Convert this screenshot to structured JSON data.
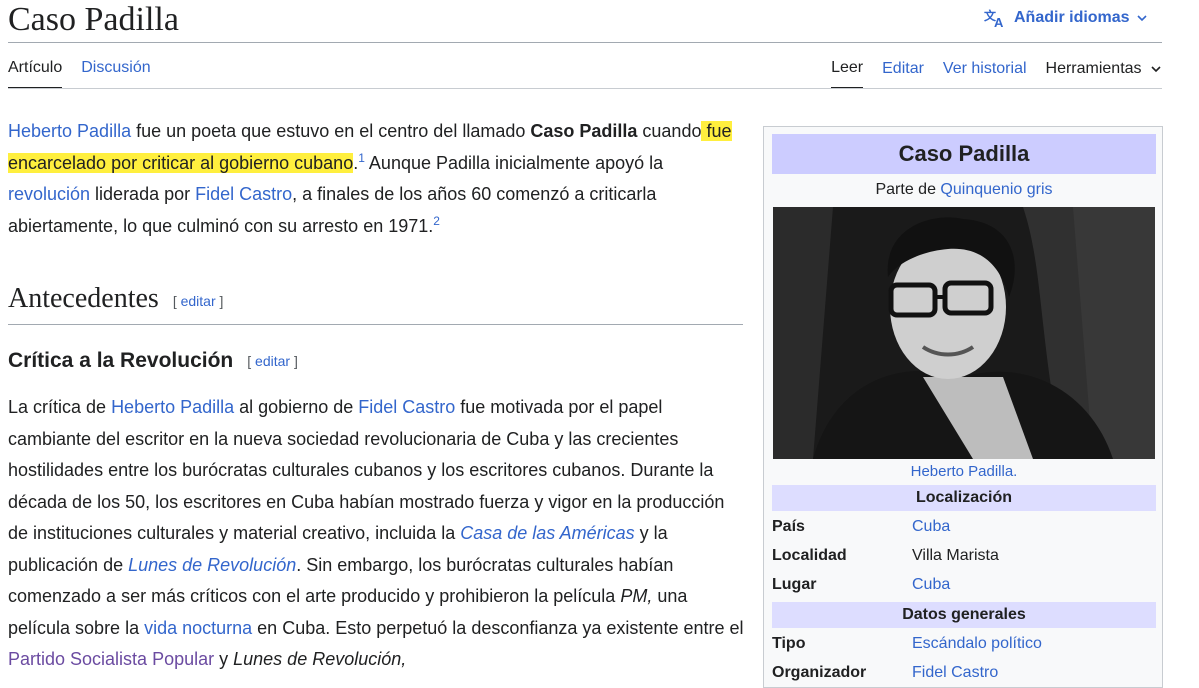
{
  "page": {
    "title": "Caso Padilla",
    "lang_button": "Añadir idiomas"
  },
  "tabs": {
    "left": [
      "Artículo",
      "Discusión"
    ],
    "right": [
      "Leer",
      "Editar",
      "Ver historial",
      "Herramientas"
    ]
  },
  "intro": {
    "link1": "Heberto Padilla",
    "t1": " fue un poeta que estuvo en el centro del llamado ",
    "bold": "Caso Padilla",
    "t2": " cuando",
    "highlight": " fue encarcelado por criticar al gobierno cubano",
    "t3": ".",
    "ref1": "1",
    "t4": "  Aunque Padilla inicialmente apoyó la ",
    "link2": "revolución",
    "t5": " liderada por ",
    "link3": "Fidel Castro",
    "t6": ", a finales de los años 60 comenzó a criticarla abiertamente, lo que culminó con su arresto en 1971.",
    "ref2": "2"
  },
  "section": {
    "heading": "Antecedentes",
    "edit_open": "[ ",
    "edit_label": "editar",
    "edit_close": " ]"
  },
  "subsection": {
    "heading": "Crítica a la Revolución",
    "edit_open": "[ ",
    "edit_label": "editar",
    "edit_close": " ]"
  },
  "body": {
    "t1": "La crítica de ",
    "link1": "Heberto Padilla",
    "t2": " al gobierno de ",
    "link2": "Fidel Castro",
    "t3": " fue motivada por el papel cambiante del escritor en la nueva sociedad revolucionaria de Cuba y las crecientes hostilidades entre los burócratas culturales cubanos y los escritores cubanos. Durante la década de los 50, los escritores en Cuba habían mostrado fuerza y vigor en la producción de instituciones culturales y material creativo, incluida la ",
    "link3": "Casa de las Américas",
    "t4": " y la publicación de ",
    "link4": "Lunes de Revolución",
    "t5": ". Sin embargo, los burócratas culturales habían comenzado a ser más críticos con el arte producido y prohibieron la película ",
    "italic1": "PM,",
    "t6": " una película sobre la ",
    "link5": "vida nocturna",
    "t7": " en Cuba. Esto perpetuó la desconfianza ya existente entre el ",
    "link6": "Partido Socialista Popular",
    "t8": " y ",
    "italic2": "Lunes de Revolución,"
  },
  "infobox": {
    "title": "Caso Padilla",
    "subtitle_prefix": "Parte de ",
    "subtitle_link": "Quinquenio gris",
    "caption": "Heberto Padilla.",
    "header1": "Localización",
    "rows1": [
      {
        "label": "País",
        "value": "Cuba"
      },
      {
        "label": "Localidad",
        "value": "Villa Marista"
      },
      {
        "label": "Lugar",
        "value": "Cuba"
      }
    ],
    "header2": "Datos generales",
    "rows2": [
      {
        "label": "Tipo",
        "value": "Escándalo político"
      },
      {
        "label": "Organizador",
        "value": "Fidel Castro"
      }
    ]
  },
  "colors": {
    "link": "#3366cc",
    "visited_link": "#6b4ba1",
    "highlight": "#ffef3e",
    "infobox_title_bg": "#ccccff",
    "infobox_header_bg": "#ddddff"
  }
}
